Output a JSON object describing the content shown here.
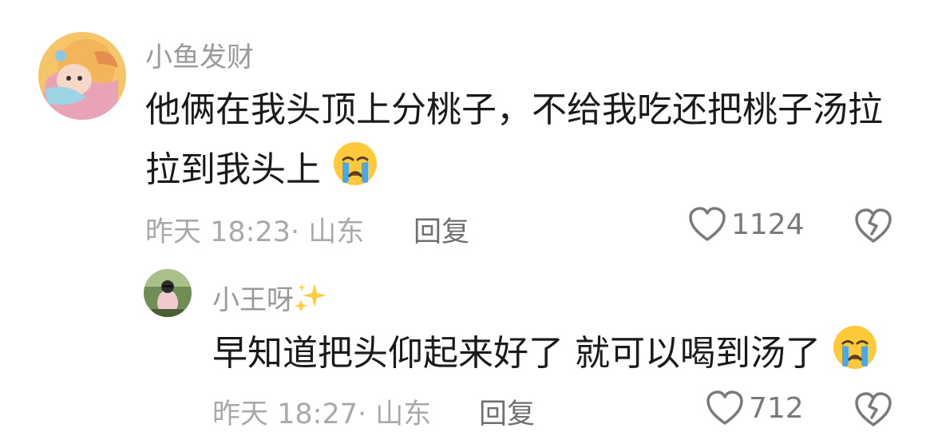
{
  "comments": [
    {
      "username": "小鱼发财",
      "text_line1": "他俩在我头顶上分桃子，不给我吃还把桃子汤拉",
      "text_line2": "拉到我头上",
      "text_emoji": "crying-face",
      "time": "昨天 18:23",
      "dot": "·",
      "location": "山东",
      "reply_label": "回复",
      "likes": "1124"
    },
    {
      "username": "小王呀",
      "username_emoji": "sparkles",
      "text": "早知道把头仰起来好了 就可以喝到汤了",
      "text_emoji": "crying-face",
      "time": "昨天 18:27",
      "dot": "·",
      "location": "山东",
      "reply_label": "回复",
      "likes": "712"
    }
  ]
}
